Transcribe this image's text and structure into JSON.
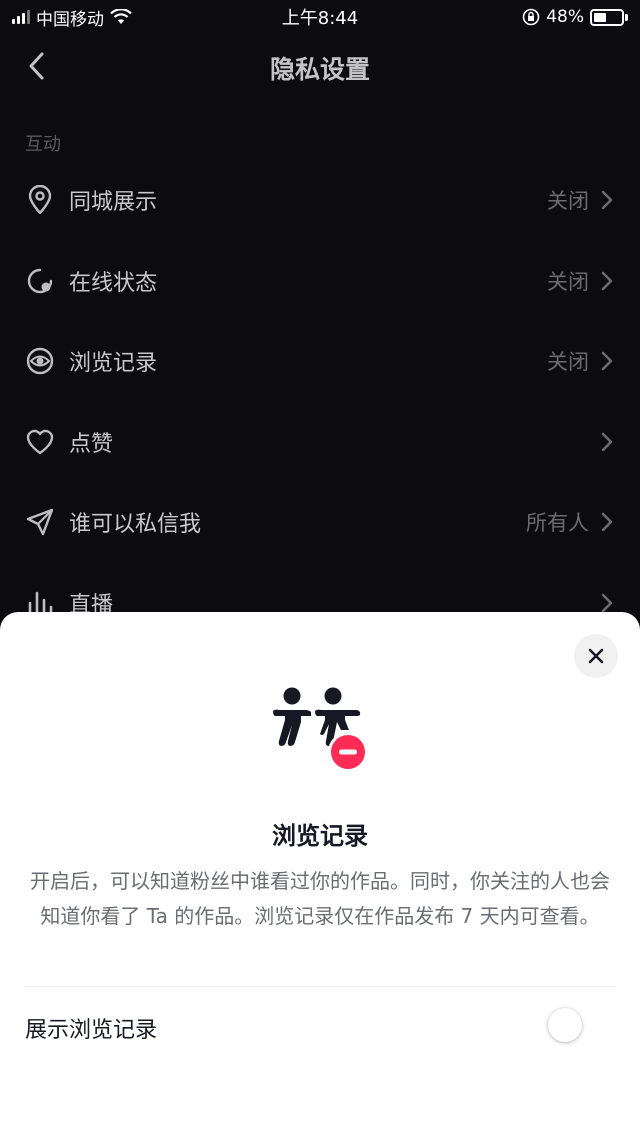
{
  "status_bar": {
    "carrier": "中国移动",
    "time": "上午8:44",
    "battery": "48%",
    "battery_level": 0.48
  },
  "header": {
    "title": "隐私设置",
    "back_icon": "chevron-left-icon"
  },
  "section": {
    "title": "互动"
  },
  "rows": [
    {
      "label": "同城展示",
      "value": "关闭",
      "icon": "location-pin-icon"
    },
    {
      "label": "在线状态",
      "value": "关闭",
      "icon": "online-status-icon"
    },
    {
      "label": "浏览记录",
      "value": "关闭",
      "icon": "eye-icon"
    },
    {
      "label": "点赞",
      "value": "",
      "icon": "heart-icon"
    },
    {
      "label": "谁可以私信我",
      "value": "所有人",
      "icon": "send-icon"
    },
    {
      "label": "直播",
      "value": "",
      "icon": "bar-chart-icon"
    }
  ],
  "sheet": {
    "title": "浏览记录",
    "description": "开启后，可以知道粉丝中谁看过你的作品。同时，你关注的人也会知道你看了 Ta 的作品。浏览记录仅在作品发布 7 天内可查看。",
    "toggle_label": "展示浏览记录",
    "toggle_on": false
  },
  "colors": {
    "background": "#0b0b10",
    "accent_red": "#fe2c55",
    "sheet_background": "#ffffff"
  }
}
